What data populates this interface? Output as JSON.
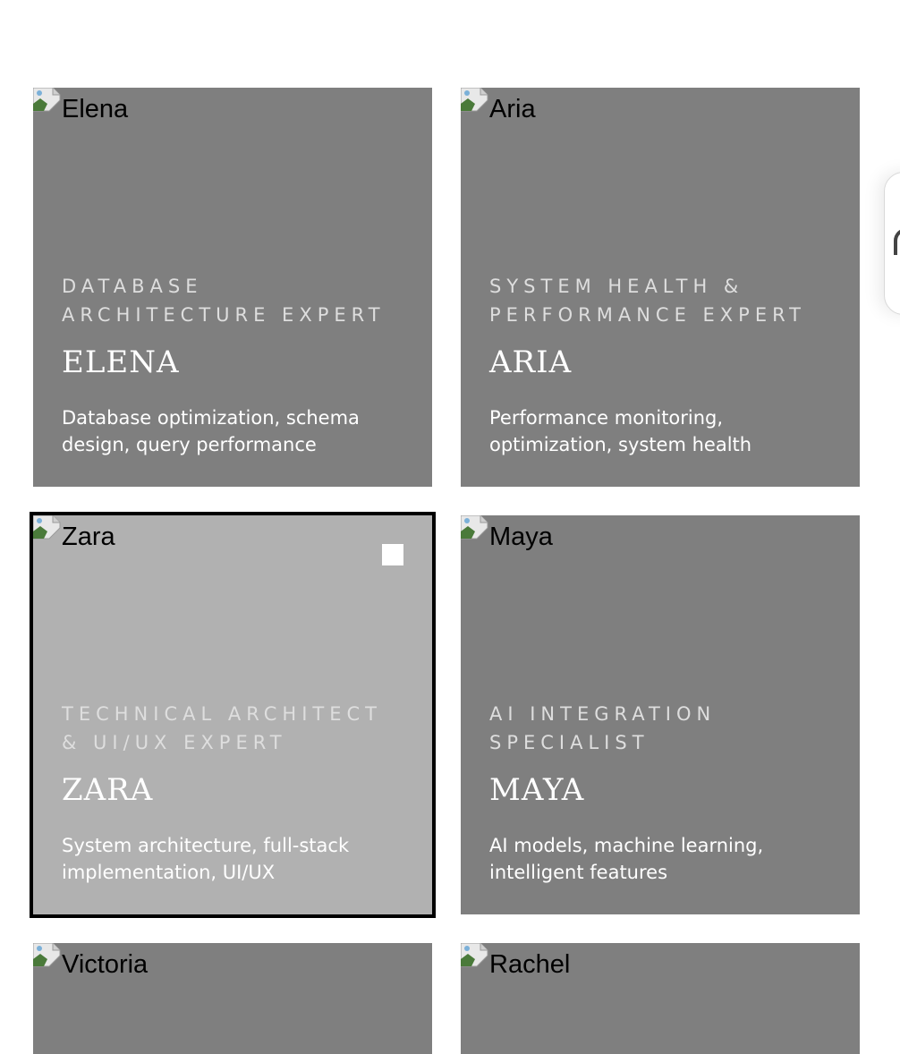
{
  "cards": [
    {
      "alt": "Elena",
      "role": "DATABASE ARCHITECTURE EXPERT",
      "name": "ELENA",
      "description": "Database optimization, schema design, query performance"
    },
    {
      "alt": "Aria",
      "role": "SYSTEM HEALTH & PERFORMANCE EXPERT",
      "name": "ARIA",
      "description": "Performance monitoring, optimization, system health"
    },
    {
      "alt": "Zara",
      "role": "TECHNICAL ARCHITECT & UI/UX EXPERT",
      "name": "ZARA",
      "description": "System architecture, full-stack implementation, UI/UX",
      "selected": true
    },
    {
      "alt": "Maya",
      "role": "AI INTEGRATION SPECIALIST",
      "name": "MAYA",
      "description": "AI models, machine learning, intelligent features"
    },
    {
      "alt": "Victoria"
    },
    {
      "alt": "Rachel"
    }
  ],
  "colors": {
    "card_bg": "#7f7f7f",
    "card_selected_bg": "#b1b1b1",
    "selected_outline": "#000000"
  },
  "icons": {
    "broken_image": "broken-image-icon",
    "select": "select-checkbox"
  }
}
